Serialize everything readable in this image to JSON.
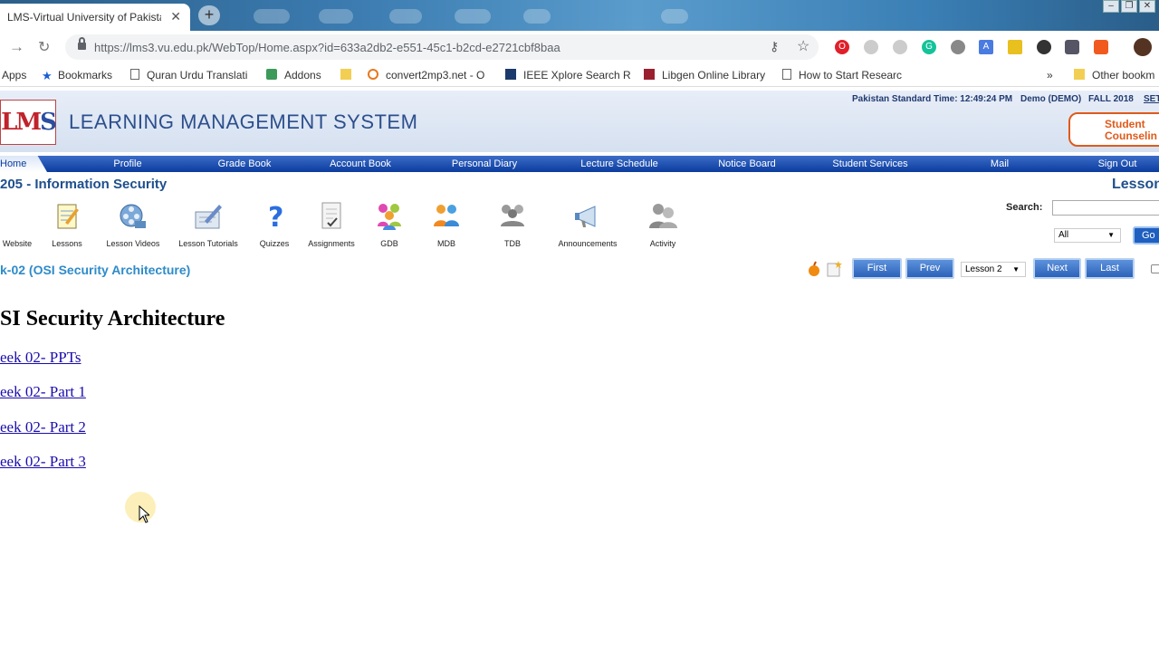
{
  "browser": {
    "tab_title": "LMS-Virtual University of Pakista",
    "url": "https://lms3.vu.edu.pk/WebTop/Home.aspx?id=633a2db2-e551-45c1-b2cd-e2721cbf8baa",
    "bookmarks": [
      {
        "label": "Apps",
        "icon": "apps-icon"
      },
      {
        "label": "Bookmarks",
        "icon": "star-icon"
      },
      {
        "label": "Quran Urdu Translati",
        "icon": "page-icon"
      },
      {
        "label": "Addons",
        "icon": "puzzle-icon"
      },
      {
        "label": "",
        "icon": "folder-icon"
      },
      {
        "label": "convert2mp3.net - O",
        "icon": "convert-icon"
      },
      {
        "label": "IEEE Xplore Search R",
        "icon": "ieee-icon"
      },
      {
        "label": "Libgen Online Library",
        "icon": "libgen-icon"
      },
      {
        "label": "How to Start Researc",
        "icon": "page-icon"
      },
      {
        "label": "»",
        "icon": "overflow-icon"
      },
      {
        "label": "Other bookm",
        "icon": "folder-icon"
      }
    ]
  },
  "lms": {
    "logo_text_red": "LM",
    "logo_text_blue": "S",
    "system_title": "LEARNING MANAGEMENT SYSTEM",
    "time_label": "Pakistan Standard Time: 12:49:24 PM",
    "user": "Demo (DEMO)",
    "semester": "FALL 2018",
    "settings_link": "SET",
    "counseling": [
      "Student",
      "Counselin"
    ],
    "nav": [
      "Home",
      "Profile",
      "Grade Book",
      "Account Book",
      "Personal Diary",
      "Lecture Schedule",
      "Notice Board",
      "Student Services",
      "Mail",
      "Sign Out"
    ],
    "course_title": "205 - Information Security",
    "lesson_heading": "Lesson",
    "tools": [
      "Website",
      "Lessons",
      "Lesson Videos",
      "Lesson Tutorials",
      "Quizzes",
      "Assignments",
      "GDB",
      "MDB",
      "TDB",
      "Announcements",
      "Activity"
    ],
    "search_label": "Search:",
    "search_value": "",
    "filter_selected": "All",
    "go_label": "Go",
    "week_title": "k-02 (OSI Security Architecture)",
    "pager": {
      "first": "First",
      "prev": "Prev",
      "lesson_selected": "Lesson 2",
      "next": "Next",
      "last": "Last"
    },
    "content_title": "SI Security Architecture",
    "links": [
      "eek 02- PPTs",
      "eek 02- Part 1",
      "eek 02- Part 2",
      "eek 02- Part 3"
    ]
  },
  "colors": {
    "nav_bar": "#0b3c9e",
    "course_title": "#1f4f8c",
    "week_title": "#2e8bc9",
    "link": "#1a0dab",
    "counseling": "#e05a1b"
  }
}
